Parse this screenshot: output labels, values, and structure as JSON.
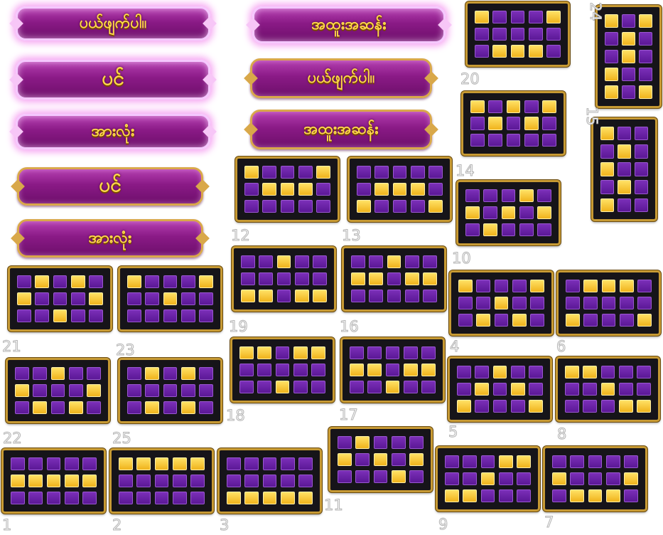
{
  "buttons": [
    {
      "label": "ပယ်ဖျက်ပါ။",
      "glow": true
    },
    {
      "label": "ပင်",
      "glow": true
    },
    {
      "label": "အားလုံး",
      "glow": true
    },
    {
      "label": "ပင်",
      "glow": false
    },
    {
      "label": "အားလုံး",
      "glow": false
    },
    {
      "label": "အထူးအဆန်း",
      "glow": true
    },
    {
      "label": "ပယ်ဖျက်ပါ။",
      "glow": false
    },
    {
      "label": "အထူးအဆန်း",
      "glow": false
    }
  ],
  "paylines": [
    {
      "id": "a",
      "label": "",
      "pattern": [
        "10001",
        "00000",
        "01110"
      ]
    },
    {
      "id": "24",
      "label": "24",
      "pattern": [
        "101",
        "010",
        "010",
        "100",
        "101"
      ]
    },
    {
      "id": "20",
      "label": "20",
      "pattern": [
        "10101",
        "01010",
        "00000"
      ]
    },
    {
      "id": "15",
      "label": "15",
      "pattern": [
        "100",
        "010",
        "100",
        "010",
        "100"
      ]
    },
    {
      "id": "b",
      "label": "",
      "pattern": [
        "10001",
        "01110",
        "00000"
      ]
    },
    {
      "id": "14",
      "label": "14",
      "pattern": [
        "00000",
        "01110",
        "10001"
      ]
    },
    {
      "id": "c",
      "label": "",
      "pattern": [
        "00010",
        "10101",
        "01000"
      ]
    },
    {
      "id": "12",
      "label": "12",
      "pattern": [
        "00100",
        "00000",
        "11011"
      ]
    },
    {
      "id": "13",
      "label": "13",
      "pattern": [
        "00100",
        "11011",
        "00000"
      ]
    },
    {
      "id": "10",
      "label": "10",
      "pattern": [
        "10001",
        "00100",
        "01010"
      ]
    },
    {
      "id": "d",
      "label": "",
      "pattern": [
        "01110",
        "00000",
        "10001"
      ]
    },
    {
      "id": "e",
      "label": "",
      "pattern": [
        "01010",
        "10001",
        "00100"
      ]
    },
    {
      "id": "f",
      "label": "",
      "pattern": [
        "10001",
        "00100",
        "00000"
      ]
    },
    {
      "id": "g",
      "label": "",
      "pattern": [
        "01110",
        "10001",
        "00000"
      ]
    },
    {
      "id": "19",
      "label": "19",
      "pattern": [
        "11011",
        "00000",
        "00100"
      ]
    },
    {
      "id": "16",
      "label": "16",
      "pattern": [
        "00000",
        "11011",
        "00100"
      ]
    },
    {
      "id": "21",
      "label": "21",
      "pattern": [
        "00100",
        "10001",
        "01010"
      ]
    },
    {
      "id": "23",
      "label": "23",
      "pattern": [
        "01010",
        "00000",
        "01010"
      ]
    },
    {
      "id": "18",
      "label": "18",
      "pattern": []
    },
    {
      "id": "4",
      "label": "4",
      "pattern": [
        "00100",
        "01010",
        "10001"
      ]
    },
    {
      "id": "6",
      "label": "6",
      "pattern": [
        "11000",
        "00100",
        "00011"
      ]
    },
    {
      "id": "17",
      "label": "17",
      "pattern": [
        "01000",
        "10101",
        "00010"
      ]
    },
    {
      "id": "5",
      "label": "5",
      "pattern": []
    },
    {
      "id": "8",
      "label": "8",
      "pattern": [
        "00000",
        "10001",
        "01110"
      ]
    },
    {
      "id": "22",
      "label": "22",
      "pattern": []
    },
    {
      "id": "25",
      "label": "25",
      "pattern": []
    },
    {
      "id": "h",
      "label": "",
      "pattern": [
        "00000",
        "11111",
        "00000"
      ]
    },
    {
      "id": "i",
      "label": "",
      "pattern": [
        "11111",
        "00000",
        "00000"
      ]
    },
    {
      "id": "j",
      "label": "",
      "pattern": [
        "00000",
        "00000",
        "11111"
      ]
    },
    {
      "id": "k",
      "label": "",
      "pattern": [
        "00011",
        "00100",
        "11000"
      ]
    },
    {
      "id": "l",
      "label": "",
      "pattern": [
        "00000",
        "10001",
        "01110"
      ]
    },
    {
      "id": "11",
      "label": "11",
      "pattern": []
    },
    {
      "id": "1",
      "label": "1",
      "pattern": []
    },
    {
      "id": "2",
      "label": "2",
      "pattern": []
    },
    {
      "id": "3",
      "label": "3",
      "pattern": []
    },
    {
      "id": "9",
      "label": "9",
      "pattern": []
    },
    {
      "id": "7",
      "label": "7",
      "pattern": []
    }
  ],
  "colors": {
    "lit": "#f5c52a",
    "unlit": "#6a23a8",
    "frame": "#c79a34",
    "button": "#8a1a86",
    "text": "#ffd84a"
  }
}
